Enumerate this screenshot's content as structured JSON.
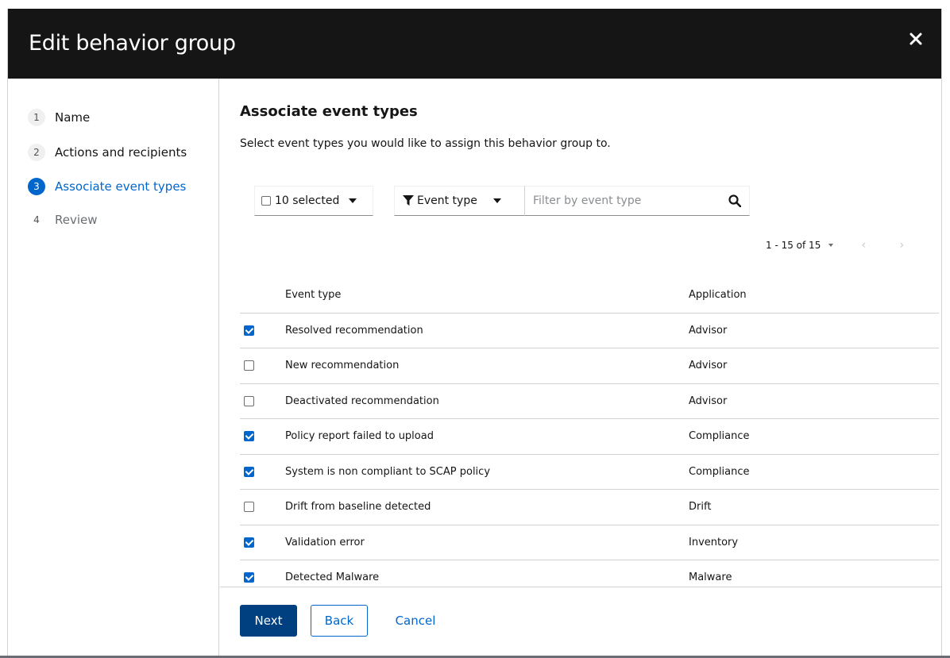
{
  "modal": {
    "title": "Edit behavior group"
  },
  "wizard_nav": {
    "steps": [
      {
        "number": "1",
        "label": "Name",
        "state": "completed"
      },
      {
        "number": "2",
        "label": "Actions and recipients",
        "state": "completed"
      },
      {
        "number": "3",
        "label": "Associate event types",
        "state": "current"
      },
      {
        "number": "4",
        "label": "Review",
        "state": "disabled"
      }
    ]
  },
  "main": {
    "title": "Associate event types",
    "description": "Select event types you would like to assign this behavior group to."
  },
  "toolbar": {
    "bulk_select_label": "10 selected",
    "filter_type_label": "Event type",
    "filter_placeholder": "Filter by event type",
    "filter_value": ""
  },
  "pagination": {
    "label": "1 - 15 of 15",
    "prev": "‹",
    "next": "›"
  },
  "table": {
    "headers": {
      "event_type": "Event type",
      "application": "Application"
    },
    "rows": [
      {
        "event_type": "Resolved recommendation",
        "application": "Advisor",
        "checked": true
      },
      {
        "event_type": "New recommendation",
        "application": "Advisor",
        "checked": false
      },
      {
        "event_type": "Deactivated recommendation",
        "application": "Advisor",
        "checked": false
      },
      {
        "event_type": "Policy report failed to upload",
        "application": "Compliance",
        "checked": true
      },
      {
        "event_type": "System is non compliant to SCAP policy",
        "application": "Compliance",
        "checked": true
      },
      {
        "event_type": "Drift from baseline detected",
        "application": "Drift",
        "checked": false
      },
      {
        "event_type": "Validation error",
        "application": "Inventory",
        "checked": true
      },
      {
        "event_type": "Detected Malware",
        "application": "Malware",
        "checked": true
      }
    ]
  },
  "footer": {
    "next_label": "Next",
    "back_label": "Back",
    "cancel_label": "Cancel"
  },
  "colors": {
    "header_bg": "#151515",
    "primary": "#0066cc",
    "primary_dark": "#004080",
    "border": "#d2d2d2"
  },
  "icons": {
    "close": "close-icon",
    "filter": "filter-icon",
    "search": "search-icon",
    "caret": "caret-down-icon"
  }
}
